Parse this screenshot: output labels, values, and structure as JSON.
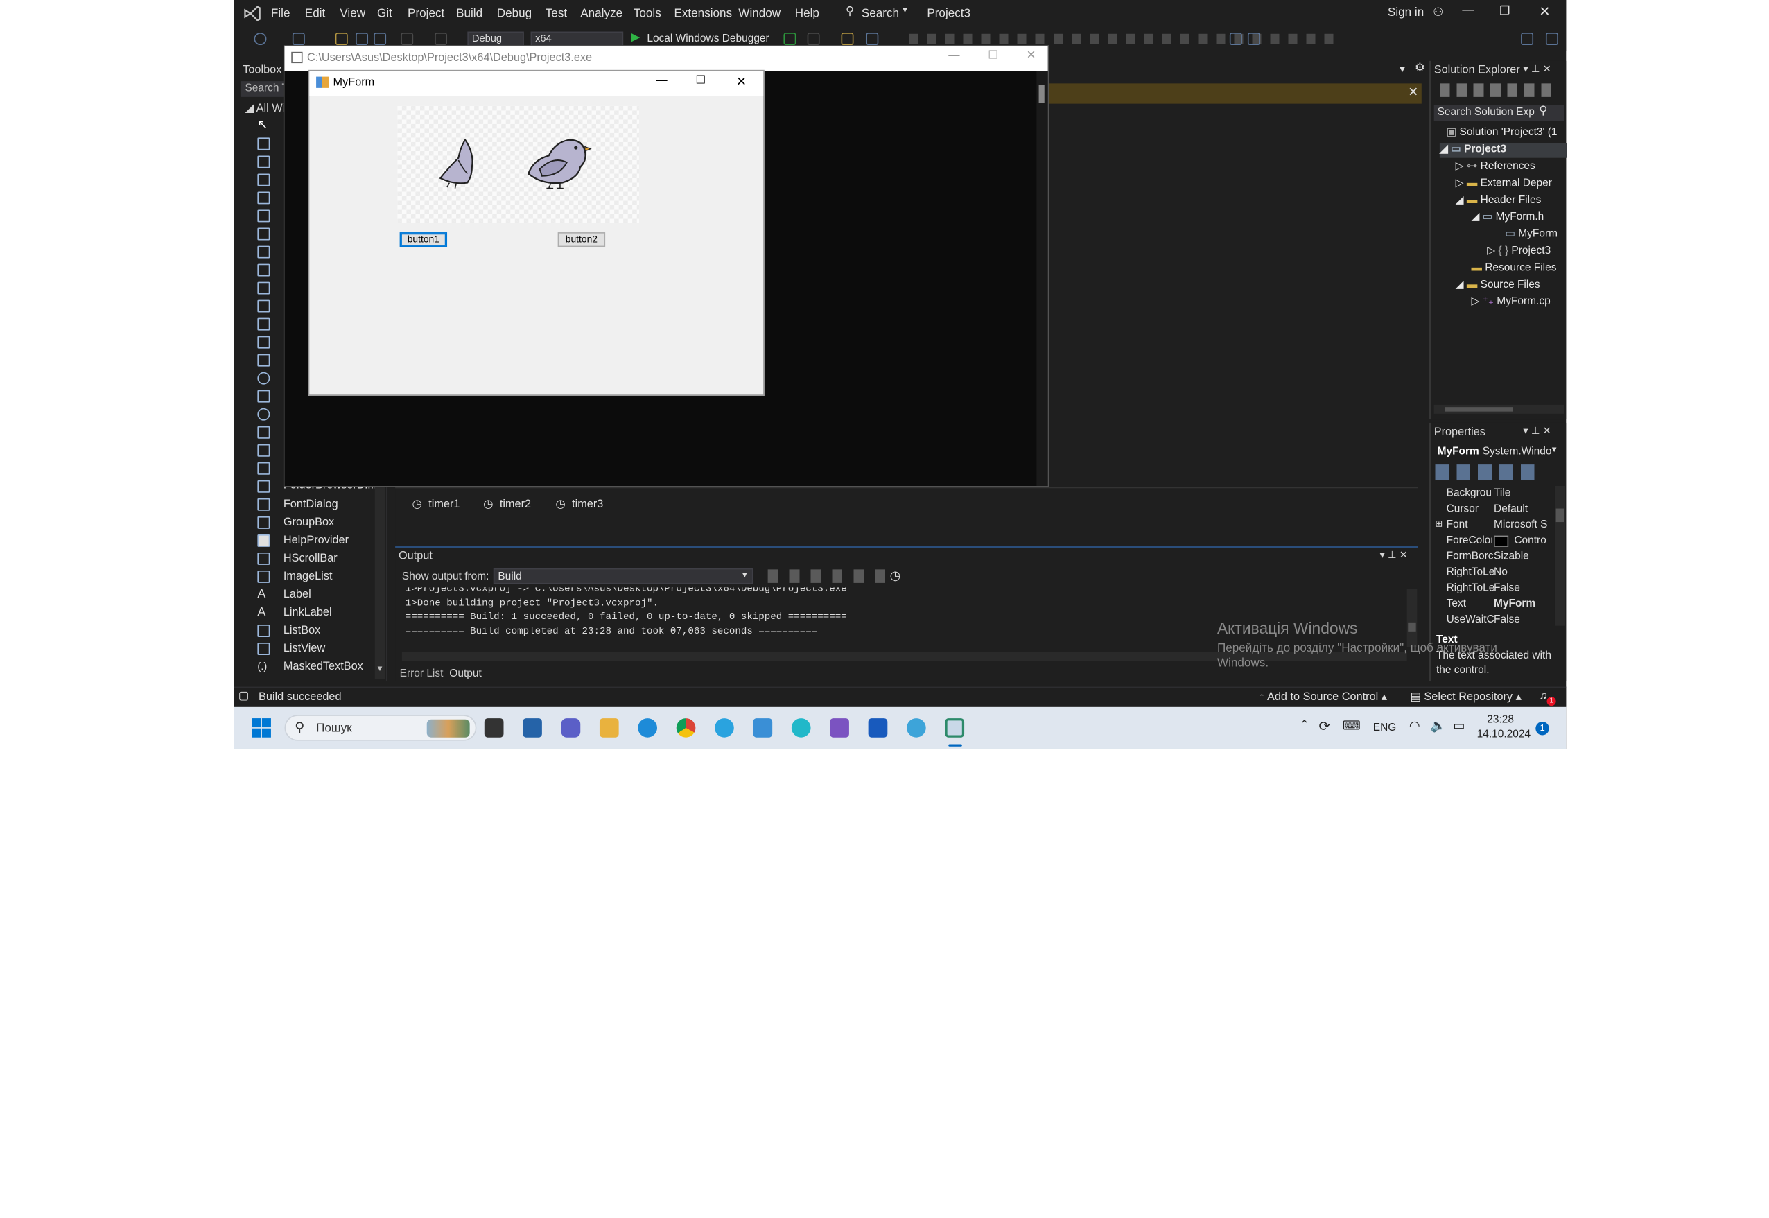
{
  "menu": [
    "File",
    "Edit",
    "View",
    "Git",
    "Project",
    "Build",
    "Debug",
    "Test",
    "Analyze",
    "Tools",
    "Extensions",
    "Window",
    "Help"
  ],
  "search_label": "Search",
  "solution_name": "Project3",
  "sign_in": "Sign in",
  "toolbar": {
    "config": "Debug",
    "platform": "x64",
    "run_label": "Local Windows Debugger"
  },
  "toolbox": {
    "title": "Toolbox",
    "search_placeholder": "Search T",
    "group": "All Wi",
    "items": [
      "FolderBrowserDi...",
      "FontDialog",
      "GroupBox",
      "HelpProvider",
      "HScrollBar",
      "ImageList",
      "Label",
      "LinkLabel",
      "ListBox",
      "ListView",
      "MaskedTextBox"
    ]
  },
  "exe_window": {
    "title": "C:\\Users\\Asus\\Desktop\\Project3\\x64\\Debug\\Project3.exe"
  },
  "myform": {
    "title": "MyForm",
    "button1": "button1",
    "button2": "button2"
  },
  "timers": [
    "timer1",
    "timer2",
    "timer3"
  ],
  "output": {
    "title": "Output",
    "show_from_label": "Show output from:",
    "source": "Build",
    "lines": [
      "1>Project3.vcxproj -> C:\\Users\\Asus\\Desktop\\Project3\\x64\\Debug\\Project3.exe",
      "1>Done building project \"Project3.vcxproj\".",
      "========== Build: 1 succeeded, 0 failed, 0 up-to-date, 0 skipped ==========",
      "========== Build completed at 23:28 and took 07,063 seconds =========="
    ],
    "tabs": [
      "Error List",
      "Output"
    ]
  },
  "solution_explorer": {
    "title": "Solution Explorer",
    "search_placeholder": "Search Solution Exp",
    "nodes": [
      "Solution 'Project3' (1",
      "Project3",
      "References",
      "External Deper",
      "Header Files",
      "MyForm.h",
      "MyForm",
      "Project3",
      "Resource Files",
      "Source Files",
      "MyForm.cp"
    ]
  },
  "properties": {
    "title": "Properties",
    "object": "MyForm",
    "object_type": "System.Windo",
    "rows": [
      {
        "name": "Backgrou",
        "value": "Tile"
      },
      {
        "name": "Cursor",
        "value": "Default"
      },
      {
        "name": "Font",
        "value": "Microsoft S"
      },
      {
        "name": "ForeColor",
        "value": "Contro"
      },
      {
        "name": "FormBorc",
        "value": "Sizable"
      },
      {
        "name": "RightToLe",
        "value": "No"
      },
      {
        "name": "RightToLe",
        "value": "False"
      },
      {
        "name": "Text",
        "value": "MyForm"
      },
      {
        "name": "UseWaitC",
        "value": "False"
      }
    ],
    "desc_title": "Text",
    "desc_text": "The text associated with the control."
  },
  "activation": {
    "title": "Активація Windows",
    "line1": "Перейдіть до розділу \"Настройки\", щоб активувати",
    "line2": "Windows."
  },
  "status": {
    "left": "Build succeeded",
    "source_control": "Add to Source Control",
    "repository": "Select Repository",
    "notifications": "1"
  },
  "taskbar": {
    "search": "Пошук",
    "lang": "ENG",
    "time": "23:28",
    "date": "14.10.2024",
    "notif": "1"
  },
  "colors": {
    "vs_bg": "#1f1f1f",
    "accent": "#0e639c",
    "run_green": "#2fb344",
    "taskbar": "#dfe6ef"
  }
}
